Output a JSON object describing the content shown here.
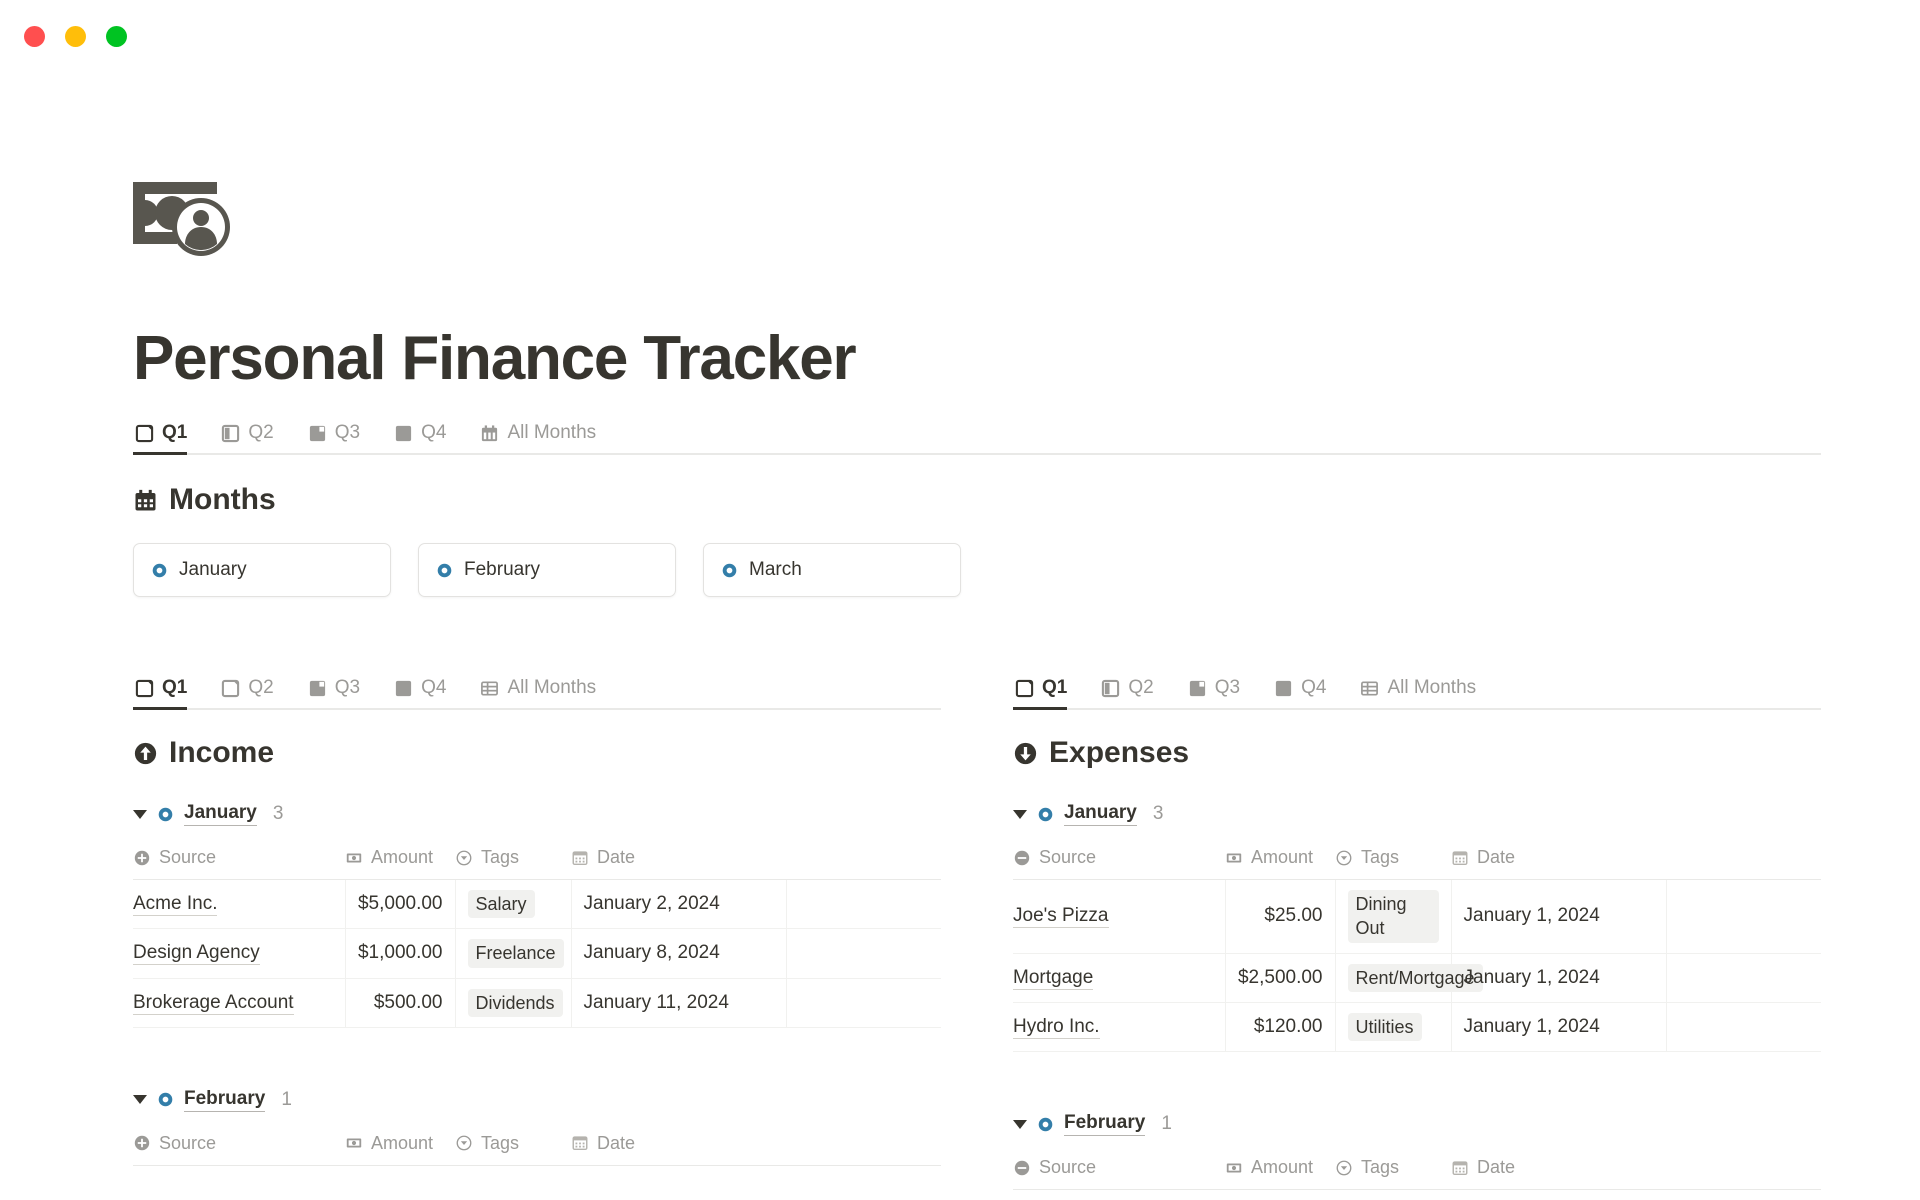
{
  "window": {
    "controls": [
      {
        "name": "close",
        "color": "#ff4f4f"
      },
      {
        "name": "minimize",
        "color": "#ffbe0a"
      },
      {
        "name": "maximize",
        "color": "#00c322"
      }
    ]
  },
  "page": {
    "icon": "money-with-face-icon",
    "title": "Personal Finance Tracker"
  },
  "top_tabs": {
    "items": [
      {
        "label": "Q1",
        "icon": "quarter-1-icon",
        "active": true
      },
      {
        "label": "Q2",
        "icon": "quarter-2-icon",
        "active": false
      },
      {
        "label": "Q3",
        "icon": "quarter-3-icon",
        "active": false
      },
      {
        "label": "Q4",
        "icon": "quarter-4-icon",
        "active": false
      },
      {
        "label": "All Months",
        "icon": "calendar-icon",
        "active": false
      }
    ]
  },
  "months_section": {
    "icon": "calendar-icon",
    "title": "Months",
    "cards": [
      {
        "label": "January",
        "icon": "blue-ring-icon"
      },
      {
        "label": "February",
        "icon": "blue-ring-icon"
      },
      {
        "label": "March",
        "icon": "blue-ring-icon"
      }
    ]
  },
  "income": {
    "tabs": [
      {
        "label": "Q1",
        "icon": "quarter-1-icon",
        "active": true
      },
      {
        "label": "Q2",
        "icon": "quarter-2-icon",
        "active": false
      },
      {
        "label": "Q3",
        "icon": "quarter-3-icon",
        "active": false
      },
      {
        "label": "Q4",
        "icon": "quarter-4-icon",
        "active": false
      },
      {
        "label": "All Months",
        "icon": "table-grid-icon",
        "active": false
      }
    ],
    "title": "Income",
    "icon": "arrow-up-circle-icon",
    "columns": [
      {
        "label": "Source",
        "icon": "plus-circle-icon"
      },
      {
        "label": "Amount",
        "icon": "money-icon"
      },
      {
        "label": "Tags",
        "icon": "select-chevron-icon"
      },
      {
        "label": "Date",
        "icon": "calendar-icon"
      }
    ],
    "groups": [
      {
        "name": "January",
        "count": "3",
        "icon": "blue-ring-icon",
        "rows": [
          {
            "source": "Acme Inc.",
            "amount": "$5,000.00",
            "tag": "Salary",
            "date": "January 2, 2024"
          },
          {
            "source": "Design Agency",
            "amount": "$1,000.00",
            "tag": "Freelance",
            "date": "January 8, 2024"
          },
          {
            "source": "Brokerage Account",
            "amount": "$500.00",
            "tag": "Dividends",
            "date": "January 11, 2024"
          }
        ]
      },
      {
        "name": "February",
        "count": "1",
        "icon": "blue-ring-icon",
        "rows": []
      }
    ]
  },
  "expenses": {
    "tabs": [
      {
        "label": "Q1",
        "icon": "quarter-1-icon",
        "active": true
      },
      {
        "label": "Q2",
        "icon": "quarter-2-icon",
        "active": false
      },
      {
        "label": "Q3",
        "icon": "quarter-3-icon",
        "active": false
      },
      {
        "label": "Q4",
        "icon": "quarter-4-icon",
        "active": false
      },
      {
        "label": "All Months",
        "icon": "table-grid-icon",
        "active": false
      }
    ],
    "title": "Expenses",
    "icon": "arrow-down-circle-icon",
    "columns": [
      {
        "label": "Source",
        "icon": "minus-circle-icon"
      },
      {
        "label": "Amount",
        "icon": "money-icon"
      },
      {
        "label": "Tags",
        "icon": "select-chevron-icon"
      },
      {
        "label": "Date",
        "icon": "calendar-icon"
      }
    ],
    "groups": [
      {
        "name": "January",
        "count": "3",
        "icon": "blue-ring-icon",
        "rows": [
          {
            "source": "Joe's Pizza",
            "amount": "$25.00",
            "tag": "Dining Out",
            "date": "January 1, 2024"
          },
          {
            "source": "Mortgage",
            "amount": "$2,500.00",
            "tag": "Rent/Mortgage",
            "date": "January 1, 2024"
          },
          {
            "source": "Hydro Inc.",
            "amount": "$120.00",
            "tag": "Utilities",
            "date": "January 1, 2024"
          }
        ]
      },
      {
        "name": "February",
        "count": "1",
        "icon": "blue-ring-icon",
        "rows": []
      }
    ]
  },
  "colors": {
    "accent_blue": "#337ea9",
    "text": "#37352f",
    "muted": "#9b9a97",
    "border": "#e9e9e7",
    "pill_bg": "#f1f1ef"
  }
}
